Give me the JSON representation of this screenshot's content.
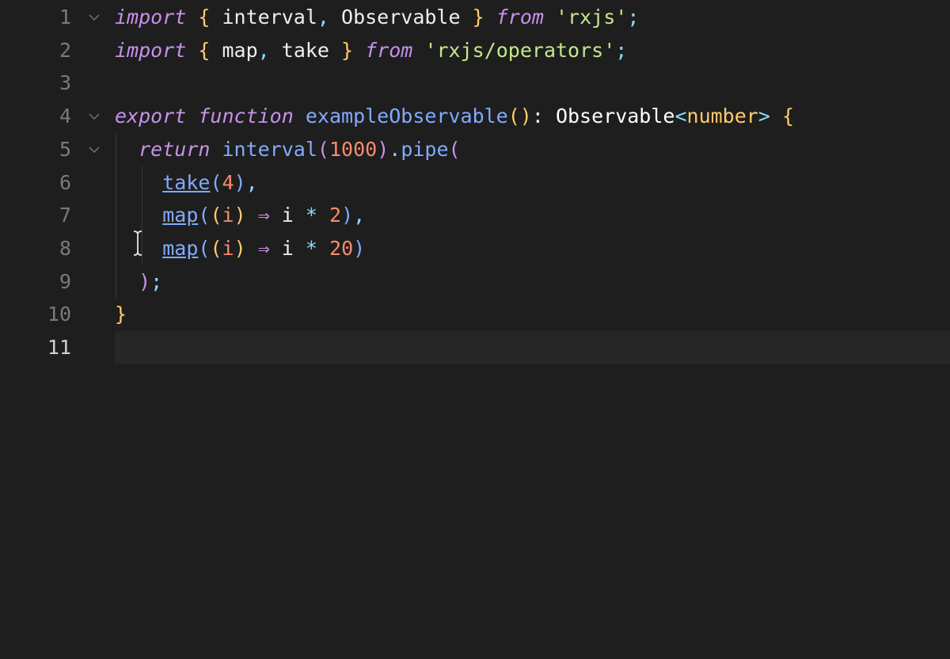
{
  "editor": {
    "line_numbers": [
      "1",
      "2",
      "3",
      "4",
      "5",
      "6",
      "7",
      "8",
      "9",
      "10",
      "11"
    ],
    "active_line": "11",
    "lines": [
      {
        "tokens": [
          {
            "t": "import",
            "c": "kw"
          },
          {
            "t": " ",
            "c": "plain"
          },
          {
            "t": "{",
            "c": "br1"
          },
          {
            "t": " interval",
            "c": "ident"
          },
          {
            "t": ",",
            "c": "punc"
          },
          {
            "t": " Observable ",
            "c": "ident"
          },
          {
            "t": "}",
            "c": "br1"
          },
          {
            "t": " ",
            "c": "plain"
          },
          {
            "t": "from",
            "c": "kw"
          },
          {
            "t": " ",
            "c": "plain"
          },
          {
            "t": "'rxjs'",
            "c": "str"
          },
          {
            "t": ";",
            "c": "punc"
          }
        ]
      },
      {
        "tokens": [
          {
            "t": "import",
            "c": "kw"
          },
          {
            "t": " ",
            "c": "plain"
          },
          {
            "t": "{",
            "c": "br1"
          },
          {
            "t": " map",
            "c": "ident"
          },
          {
            "t": ",",
            "c": "punc"
          },
          {
            "t": " take ",
            "c": "ident"
          },
          {
            "t": "}",
            "c": "br1"
          },
          {
            "t": " ",
            "c": "plain"
          },
          {
            "t": "from",
            "c": "kw"
          },
          {
            "t": " ",
            "c": "plain"
          },
          {
            "t": "'rxjs/operators'",
            "c": "str"
          },
          {
            "t": ";",
            "c": "punc"
          }
        ]
      },
      {
        "tokens": []
      },
      {
        "tokens": [
          {
            "t": "export",
            "c": "kw"
          },
          {
            "t": " ",
            "c": "plain"
          },
          {
            "t": "function",
            "c": "kw"
          },
          {
            "t": " ",
            "c": "plain"
          },
          {
            "t": "exampleObservable",
            "c": "fn"
          },
          {
            "t": "()",
            "c": "br1"
          },
          {
            "t": ": ",
            "c": "plain"
          },
          {
            "t": "Observable",
            "c": "type"
          },
          {
            "t": "<",
            "c": "punc"
          },
          {
            "t": "number",
            "c": "typeParam"
          },
          {
            "t": ">",
            "c": "punc"
          },
          {
            "t": " ",
            "c": "plain"
          },
          {
            "t": "{",
            "c": "br1"
          }
        ]
      },
      {
        "tokens": [
          {
            "t": "  ",
            "c": "plain"
          },
          {
            "t": "return",
            "c": "kw"
          },
          {
            "t": " ",
            "c": "plain"
          },
          {
            "t": "interval",
            "c": "fn"
          },
          {
            "t": "(",
            "c": "br2"
          },
          {
            "t": "1000",
            "c": "num"
          },
          {
            "t": ")",
            "c": "br2"
          },
          {
            "t": ".",
            "c": "punc"
          },
          {
            "t": "pipe",
            "c": "fn"
          },
          {
            "t": "(",
            "c": "br2"
          }
        ]
      },
      {
        "tokens": [
          {
            "t": "    ",
            "c": "plain"
          },
          {
            "t": "take",
            "c": "fnu"
          },
          {
            "t": "(",
            "c": "br3"
          },
          {
            "t": "4",
            "c": "num"
          },
          {
            "t": ")",
            "c": "br3"
          },
          {
            "t": ",",
            "c": "punc"
          }
        ]
      },
      {
        "tokens": [
          {
            "t": "    ",
            "c": "plain"
          },
          {
            "t": "map",
            "c": "fnu"
          },
          {
            "t": "(",
            "c": "br3"
          },
          {
            "t": "(",
            "c": "br1"
          },
          {
            "t": "i",
            "c": "num"
          },
          {
            "t": ")",
            "c": "br1"
          },
          {
            "t": " ",
            "c": "plain"
          },
          {
            "t": "⇒",
            "c": "op"
          },
          {
            "t": " i ",
            "c": "ident"
          },
          {
            "t": "*",
            "c": "punc"
          },
          {
            "t": " ",
            "c": "plain"
          },
          {
            "t": "2",
            "c": "num"
          },
          {
            "t": ")",
            "c": "br3"
          },
          {
            "t": ",",
            "c": "punc"
          }
        ]
      },
      {
        "tokens": [
          {
            "t": "    ",
            "c": "plain"
          },
          {
            "t": "map",
            "c": "fnu"
          },
          {
            "t": "(",
            "c": "br3"
          },
          {
            "t": "(",
            "c": "br1"
          },
          {
            "t": "i",
            "c": "num"
          },
          {
            "t": ")",
            "c": "br1"
          },
          {
            "t": " ",
            "c": "plain"
          },
          {
            "t": "⇒",
            "c": "op"
          },
          {
            "t": " i ",
            "c": "ident"
          },
          {
            "t": "*",
            "c": "punc"
          },
          {
            "t": " ",
            "c": "plain"
          },
          {
            "t": "20",
            "c": "num"
          },
          {
            "t": ")",
            "c": "br3"
          }
        ]
      },
      {
        "tokens": [
          {
            "t": "  ",
            "c": "plain"
          },
          {
            "t": ")",
            "c": "br2"
          },
          {
            "t": ";",
            "c": "punc"
          }
        ]
      },
      {
        "tokens": [
          {
            "t": "}",
            "c": "br1"
          }
        ]
      },
      {
        "tokens": []
      }
    ],
    "fold_markers": [
      "1",
      "4",
      "5"
    ],
    "fold_icon": "chevron-down-icon",
    "cursor_icon": "text-cursor-icon"
  }
}
